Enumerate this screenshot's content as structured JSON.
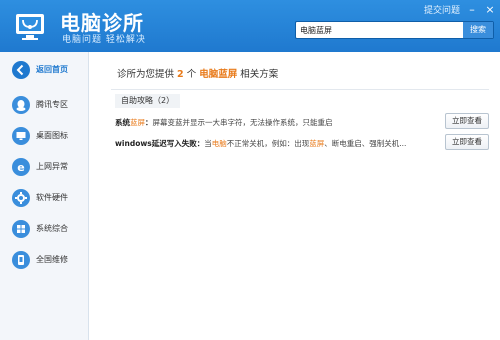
{
  "header": {
    "title": "电脑诊所",
    "subtitle": "电脑问题 轻松解决",
    "feedback": "提交问题",
    "search": {
      "value": "电脑蓝屏",
      "button": "搜索"
    }
  },
  "sidebar": {
    "items": [
      {
        "label": "返回首页",
        "icon": "back-arrow-icon"
      },
      {
        "label": "腾讯专区",
        "icon": "tencent-icon"
      },
      {
        "label": "桌面图标",
        "icon": "desktop-icon"
      },
      {
        "label": "上网异常",
        "icon": "internet-icon"
      },
      {
        "label": "软件硬件",
        "icon": "software-hardware-icon"
      },
      {
        "label": "系统综合",
        "icon": "windows-icon"
      },
      {
        "label": "全国维修",
        "icon": "repair-icon"
      }
    ]
  },
  "main": {
    "summary": {
      "prefix": "诊所为您提供",
      "count": "2",
      "unit": "个",
      "keyword": "电脑蓝屏",
      "suffix": "相关方案"
    },
    "section": "自助攻略（2）",
    "results": [
      {
        "title_prefix": "系统",
        "title_hl": "蓝屏",
        "title_suffix": "：",
        "desc_a": "屏幕变蓝并显示一大串字符，无法操作系统，只能重启",
        "desc_hl": "",
        "desc_b": "",
        "desc_hl2": "",
        "desc_c": "",
        "button": "立即查看"
      },
      {
        "title_prefix": "windows延迟写入失败",
        "title_hl": "",
        "title_suffix": "：",
        "desc_a": "当",
        "desc_hl": "电脑",
        "desc_b": "不正常关机，例如：出现",
        "desc_hl2": "蓝屏",
        "desc_c": "、断电重启、强制关机...",
        "button": "立即查看"
      }
    ]
  },
  "colors": {
    "header": "#1f79cf",
    "accent": "#3a8edc",
    "highlight": "#e87a1a"
  }
}
